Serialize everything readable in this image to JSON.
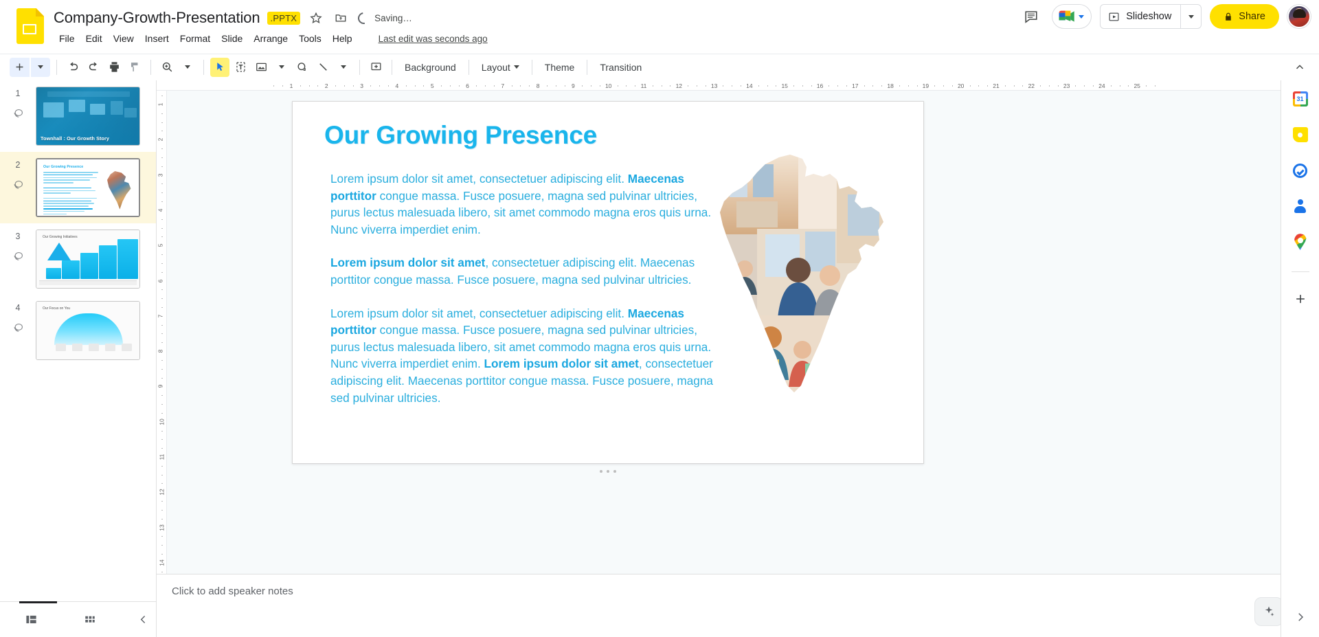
{
  "header": {
    "doc_icon": "slides-file-icon",
    "title": "Company-Growth-Presentation",
    "format_badge": ".PPTX",
    "star_icon": "star-icon",
    "move_icon": "move-to-folder-icon",
    "sync_icon": "sync-icon",
    "save_status": "Saving…",
    "menu": [
      {
        "label": "File"
      },
      {
        "label": "Edit"
      },
      {
        "label": "View"
      },
      {
        "label": "Insert"
      },
      {
        "label": "Format"
      },
      {
        "label": "Slide"
      },
      {
        "label": "Arrange"
      },
      {
        "label": "Tools"
      },
      {
        "label": "Help"
      }
    ],
    "last_edit": "Last edit was seconds ago",
    "comment_icon": "comment-history-icon",
    "meet_icon": "google-meet-icon",
    "slideshow_label": "Slideshow",
    "slideshow_icon": "present-icon",
    "share_label": "Share",
    "share_lock_icon": "lock-icon",
    "avatar": "user-avatar",
    "share_bg": "#FFE000",
    "badge_bg": "#FFE000"
  },
  "toolbar": {
    "new_slide": "new-slide-icon",
    "undo": "undo-icon",
    "redo": "redo-icon",
    "print": "print-icon",
    "paint_format": "paint-format-icon",
    "zoom": "zoom-icon",
    "select": "select-cursor-icon",
    "textbox": "text-box-icon",
    "image": "insert-image-icon",
    "shape": "shape-icon",
    "line": "line-icon",
    "comment": "add-comment-icon",
    "background_label": "Background",
    "layout_label": "Layout",
    "theme_label": "Theme",
    "transition_label": "Transition",
    "collapse_icon": "collapse-menu-icon",
    "active_tool_highlight": "#FFF176"
  },
  "filmstrip": {
    "slides": [
      {
        "number": "1",
        "title": "Townhall : Our Growth Story",
        "layers_icon": "layers-icon"
      },
      {
        "number": "2",
        "title": "Our Growing Presence",
        "layers_icon": "layers-icon",
        "selected": true
      },
      {
        "number": "3",
        "title": "Our Growing Initiatives",
        "layers_icon": "layers-icon"
      },
      {
        "number": "4",
        "title": "Our Focus on You",
        "layers_icon": "layers-icon"
      }
    ]
  },
  "rulers": {
    "horizontal_ticks": [
      "1",
      "2",
      "3",
      "4",
      "5",
      "6",
      "7",
      "8",
      "9",
      "10",
      "11",
      "12",
      "13",
      "14",
      "15",
      "16",
      "17",
      "18",
      "19",
      "20",
      "21",
      "22",
      "23",
      "24",
      "25"
    ],
    "vertical_ticks": [
      "1",
      "2",
      "3",
      "4",
      "5",
      "6",
      "7",
      "8",
      "9",
      "10",
      "11",
      "12",
      "13",
      "14"
    ]
  },
  "slide": {
    "title": "Our Growing Presence",
    "title_color": "#19B5EC",
    "body_color": "#2AAEDE",
    "paragraphs": [
      {
        "runs": [
          {
            "text": "Lorem ipsum dolor sit amet, consectetuer adipiscing elit. ",
            "bold": false
          },
          {
            "text": "Maecenas porttitor",
            "bold": true
          },
          {
            "text": " congue massa. Fusce posuere, magna sed pulvinar ultricies, purus lectus malesuada libero, sit amet commodo magna eros quis urna. Nunc viverra imperdiet enim.",
            "bold": false
          }
        ]
      },
      {
        "runs": [
          {
            "text": "Lorem ipsum dolor sit amet",
            "bold": true
          },
          {
            "text": ", consectetuer adipiscing elit. Maecenas porttitor congue massa. Fusce posuere, magna sed pulvinar ultricies.",
            "bold": false
          }
        ]
      },
      {
        "runs": [
          {
            "text": "Lorem ipsum dolor sit amet, consectetuer adipiscing elit. ",
            "bold": false
          },
          {
            "text": "Maecenas porttitor",
            "bold": true
          },
          {
            "text": " congue massa. Fusce posuere, magna sed pulvinar ultricies, purus lectus malesuada libero, sit amet commodo magna eros quis urna. Nunc viverra imperdiet enim. ",
            "bold": false
          },
          {
            "text": "Lorem ipsum dolor sit amet",
            "bold": true
          },
          {
            "text": ", consectetuer adipiscing elit. Maecenas porttitor congue massa. Fusce posuere, magna sed pulvinar ultricies.",
            "bold": false
          }
        ]
      }
    ],
    "image_alt": "india-map-photo-collage"
  },
  "notes": {
    "placeholder": "Click to add speaker notes",
    "explore_icon": "explore-icon",
    "expand_icon": "expand-notes-icon"
  },
  "statusbar": {
    "filmstrip_view_icon": "filmstrip-view-icon",
    "grid_view_icon": "grid-view-icon",
    "collapse_icon": "collapse-filmstrip-icon"
  },
  "sidepanel": {
    "items": [
      {
        "icon": "google-calendar-icon",
        "name": "calendar"
      },
      {
        "icon": "google-keep-icon",
        "name": "keep"
      },
      {
        "icon": "google-tasks-icon",
        "name": "tasks"
      },
      {
        "icon": "google-contacts-icon",
        "name": "contacts"
      },
      {
        "icon": "google-maps-icon",
        "name": "maps"
      }
    ],
    "add_icon": "add-addon-icon",
    "expand_icon": "expand-side-panel-icon"
  }
}
